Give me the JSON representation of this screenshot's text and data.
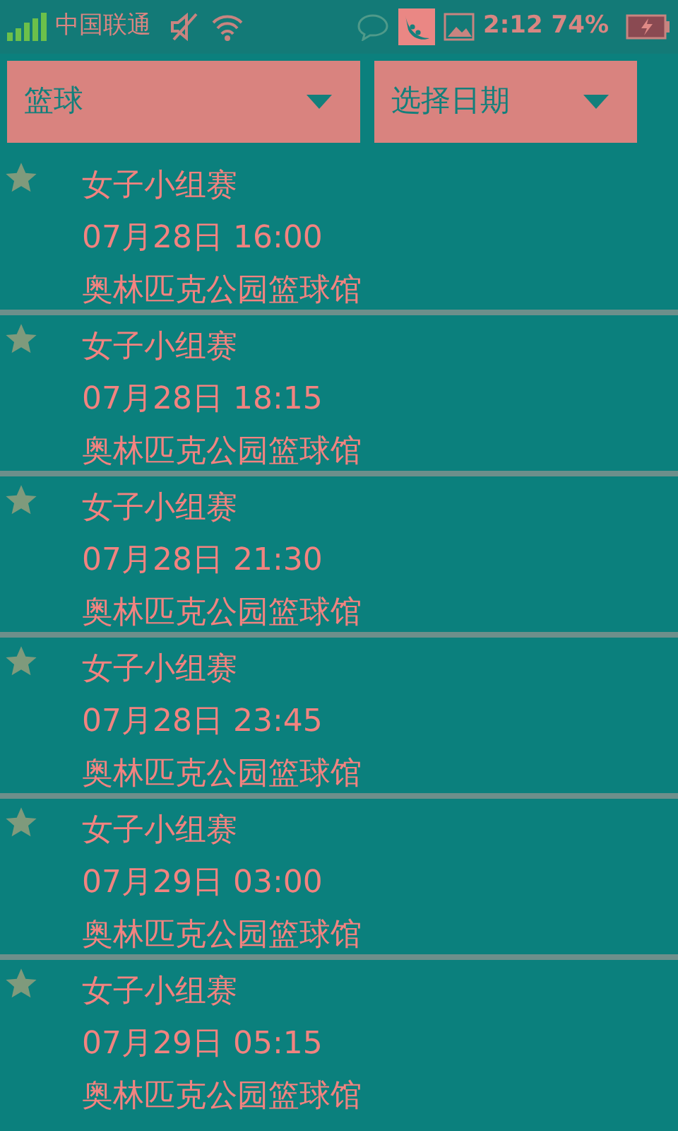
{
  "status_bar": {
    "carrier": "中国联通",
    "time": "2:12",
    "battery": "74%"
  },
  "filters": [
    {
      "label": "篮球"
    },
    {
      "label": "选择日期"
    }
  ],
  "matches": [
    {
      "title": "女子小组赛",
      "datetime": "07月28日 16:00",
      "venue": "奥林匹克公园篮球馆"
    },
    {
      "title": "女子小组赛",
      "datetime": "07月28日 18:15",
      "venue": "奥林匹克公园篮球馆"
    },
    {
      "title": "女子小组赛",
      "datetime": "07月28日 21:30",
      "venue": "奥林匹克公园篮球馆"
    },
    {
      "title": "女子小组赛",
      "datetime": "07月28日 23:45",
      "venue": "奥林匹克公园篮球馆"
    },
    {
      "title": "女子小组赛",
      "datetime": "07月29日 03:00",
      "venue": "奥林匹克公园篮球馆"
    },
    {
      "title": "女子小组赛",
      "datetime": "07月29日 05:15",
      "venue": "奥林匹克公园篮球馆"
    }
  ]
}
